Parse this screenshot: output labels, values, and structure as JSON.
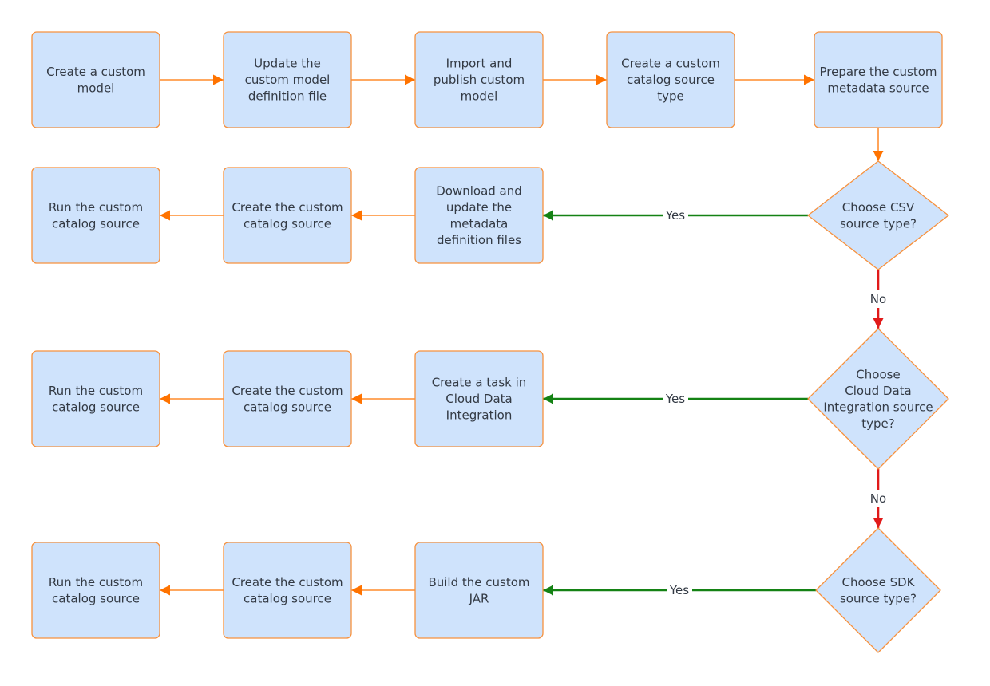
{
  "colors": {
    "node_fill": "#cfe3fc",
    "node_stroke": "#f7913d",
    "flow": "#ff7300",
    "yes": "#148214",
    "no": "#e11a1a"
  },
  "nodes": [
    {
      "id": "n1",
      "shape": "box",
      "lines": [
        "Create a custom",
        "model"
      ]
    },
    {
      "id": "n2",
      "shape": "box",
      "lines": [
        "Update the",
        "custom model",
        "definition file"
      ]
    },
    {
      "id": "n3",
      "shape": "box",
      "lines": [
        "Import and",
        "publish custom",
        "model"
      ]
    },
    {
      "id": "n4",
      "shape": "box",
      "lines": [
        "Create a custom",
        "catalog source",
        "type"
      ]
    },
    {
      "id": "n5",
      "shape": "box",
      "lines": [
        "Prepare the custom",
        "metadata source"
      ]
    },
    {
      "id": "d1",
      "shape": "diamond",
      "lines": [
        "Choose CSV",
        "source type?"
      ]
    },
    {
      "id": "r1c",
      "shape": "box",
      "lines": [
        "Download and",
        "update the",
        "metadata",
        "definition files"
      ]
    },
    {
      "id": "r1b",
      "shape": "box",
      "lines": [
        "Create the custom",
        "catalog source"
      ]
    },
    {
      "id": "r1a",
      "shape": "box",
      "lines": [
        "Run the custom",
        "catalog source"
      ]
    },
    {
      "id": "d2",
      "shape": "diamond",
      "lines": [
        "Choose",
        "Cloud Data",
        "Integration source",
        "type?"
      ]
    },
    {
      "id": "r2c",
      "shape": "box",
      "lines": [
        "Create a task in",
        "Cloud Data",
        "Integration"
      ]
    },
    {
      "id": "r2b",
      "shape": "box",
      "lines": [
        "Create the custom",
        "catalog source"
      ]
    },
    {
      "id": "r2a",
      "shape": "box",
      "lines": [
        "Run the custom",
        "catalog source"
      ]
    },
    {
      "id": "d3",
      "shape": "diamond",
      "lines": [
        "Choose SDK",
        "source type?"
      ]
    },
    {
      "id": "r3c",
      "shape": "box",
      "lines": [
        "Build the custom",
        "JAR"
      ]
    },
    {
      "id": "r3b",
      "shape": "box",
      "lines": [
        "Create the custom",
        "catalog source"
      ]
    },
    {
      "id": "r3a",
      "shape": "box",
      "lines": [
        "Run the custom",
        "catalog source"
      ]
    }
  ],
  "edges": [
    {
      "from": "n1",
      "to": "n2",
      "kind": "flow",
      "label": ""
    },
    {
      "from": "n2",
      "to": "n3",
      "kind": "flow",
      "label": ""
    },
    {
      "from": "n3",
      "to": "n4",
      "kind": "flow",
      "label": ""
    },
    {
      "from": "n4",
      "to": "n5",
      "kind": "flow",
      "label": ""
    },
    {
      "from": "n5",
      "to": "d1",
      "kind": "flow",
      "label": ""
    },
    {
      "from": "d1",
      "to": "r1c",
      "kind": "yes",
      "label": "Yes"
    },
    {
      "from": "r1c",
      "to": "r1b",
      "kind": "flow",
      "label": ""
    },
    {
      "from": "r1b",
      "to": "r1a",
      "kind": "flow",
      "label": ""
    },
    {
      "from": "d1",
      "to": "d2",
      "kind": "no",
      "label": "No"
    },
    {
      "from": "d2",
      "to": "r2c",
      "kind": "yes",
      "label": "Yes"
    },
    {
      "from": "r2c",
      "to": "r2b",
      "kind": "flow",
      "label": ""
    },
    {
      "from": "r2b",
      "to": "r2a",
      "kind": "flow",
      "label": ""
    },
    {
      "from": "d2",
      "to": "d3",
      "kind": "no",
      "label": "No"
    },
    {
      "from": "d3",
      "to": "r3c",
      "kind": "yes",
      "label": "Yes"
    },
    {
      "from": "r3c",
      "to": "r3b",
      "kind": "flow",
      "label": ""
    },
    {
      "from": "r3b",
      "to": "r3a",
      "kind": "flow",
      "label": ""
    }
  ]
}
